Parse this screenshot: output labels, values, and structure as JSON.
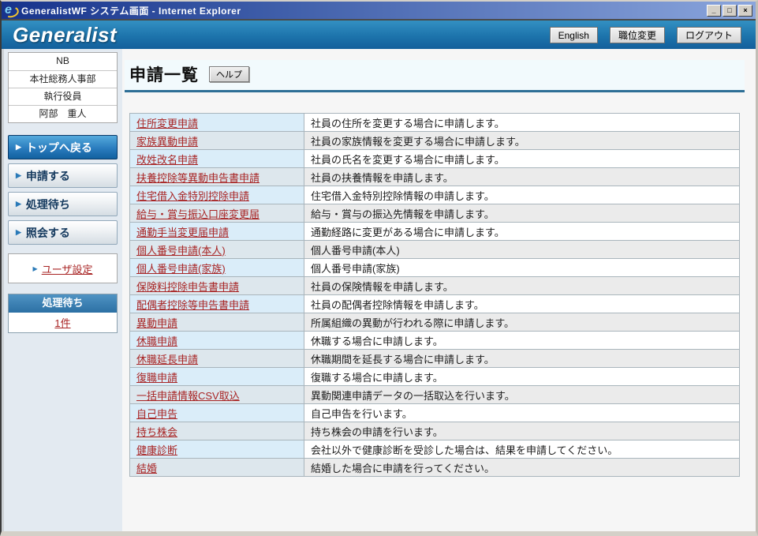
{
  "window": {
    "title": "GeneralistWF システム画面 - Internet Explorer",
    "controls": {
      "minimize": "_",
      "maximize": "□",
      "close": "×"
    }
  },
  "header": {
    "logo": "Generalist",
    "buttons": [
      {
        "label": "English"
      },
      {
        "label": "職位変更"
      },
      {
        "label": "ログアウト"
      }
    ]
  },
  "sidebar": {
    "user_info": [
      "NB",
      "本社総務人事部",
      "執行役員",
      "阿部　重人"
    ],
    "nav": [
      {
        "label": "トップへ戻る",
        "active": true
      },
      {
        "label": "申請する",
        "active": false
      },
      {
        "label": "処理待ち",
        "active": false
      },
      {
        "label": "照会する",
        "active": false
      }
    ],
    "user_settings_link": "ユーザ設定",
    "pending": {
      "title": "処理待ち",
      "count_link": "1件"
    }
  },
  "main": {
    "page_title": "申請一覧",
    "help_button": "ヘルプ",
    "applications": [
      {
        "name": "住所変更申請",
        "description": "社員の住所を変更する場合に申請します。"
      },
      {
        "name": "家族異動申請",
        "description": "社員の家族情報を変更する場合に申請します。"
      },
      {
        "name": "改姓改名申請",
        "description": "社員の氏名を変更する場合に申請します。"
      },
      {
        "name": "扶養控除等異動申告書申請",
        "description": "社員の扶養情報を申請します。"
      },
      {
        "name": "住宅借入金特別控除申請",
        "description": "住宅借入金特別控除情報の申請します。"
      },
      {
        "name": "給与・賞与振込口座変更届",
        "description": "給与・賞与の振込先情報を申請します。"
      },
      {
        "name": "通勤手当変更届申請",
        "description": "通勤経路に変更がある場合に申請します。"
      },
      {
        "name": "個人番号申請(本人)",
        "description": "個人番号申請(本人)"
      },
      {
        "name": "個人番号申請(家族)",
        "description": "個人番号申請(家族)"
      },
      {
        "name": "保険料控除申告書申請",
        "description": "社員の保険情報を申請します。"
      },
      {
        "name": "配偶者控除等申告書申請",
        "description": "社員の配偶者控除情報を申請します。"
      },
      {
        "name": "異動申請",
        "description": "所属組織の異動が行われる際に申請します。"
      },
      {
        "name": "休職申請",
        "description": "休職する場合に申請します。"
      },
      {
        "name": "休職延長申請",
        "description": "休職期間を延長する場合に申請します。"
      },
      {
        "name": "復職申請",
        "description": "復職する場合に申請します。"
      },
      {
        "name": "一括申請情報CSV取込",
        "description": "異動関連申請データの一括取込を行います。"
      },
      {
        "name": "自己申告",
        "description": "自己申告を行います。"
      },
      {
        "name": "持ち株会",
        "description": "持ち株会の申請を行います。"
      },
      {
        "name": "健康診断",
        "description": "会社以外で健康診断を受診した場合は、結果を申請してください。"
      },
      {
        "name": "結婚",
        "description": "結婚した場合に申請を行ってください。"
      }
    ]
  },
  "colors": {
    "accent_blue": "#1d74ac",
    "active_nav_blue": "#2a7cbe",
    "link_red": "#a82424",
    "title_underline": "#2e6f96",
    "row_blue": "#daedf9"
  }
}
